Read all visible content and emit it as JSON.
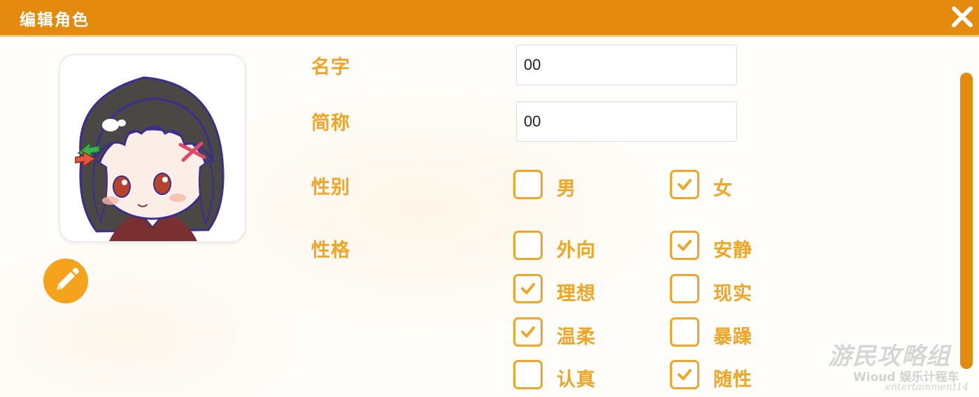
{
  "window": {
    "title": "编辑角色",
    "close_icon": "close-icon",
    "accent_color": "#e48a0f",
    "label_color": "#f0a526"
  },
  "avatar": {
    "image": "chibi-girl-portrait",
    "edit_icon": "pencil-icon"
  },
  "form": {
    "name": {
      "label": "名字",
      "value": "00"
    },
    "short_name": {
      "label": "简称",
      "value": "00"
    },
    "gender": {
      "label": "性别",
      "options": [
        {
          "label": "男",
          "checked": false
        },
        {
          "label": "女",
          "checked": true
        }
      ]
    },
    "personality": {
      "label": "性格",
      "options": [
        {
          "label": "外向",
          "checked": false
        },
        {
          "label": "安静",
          "checked": true
        },
        {
          "label": "理想",
          "checked": true
        },
        {
          "label": "现实",
          "checked": false
        },
        {
          "label": "温柔",
          "checked": true
        },
        {
          "label": "暴躁",
          "checked": false
        },
        {
          "label": "认真",
          "checked": false
        },
        {
          "label": "随性",
          "checked": true
        }
      ]
    }
  },
  "watermark": {
    "main": "游民攻略组",
    "sub": "Wioud 娱乐计程车",
    "tag": "entertainment14"
  }
}
